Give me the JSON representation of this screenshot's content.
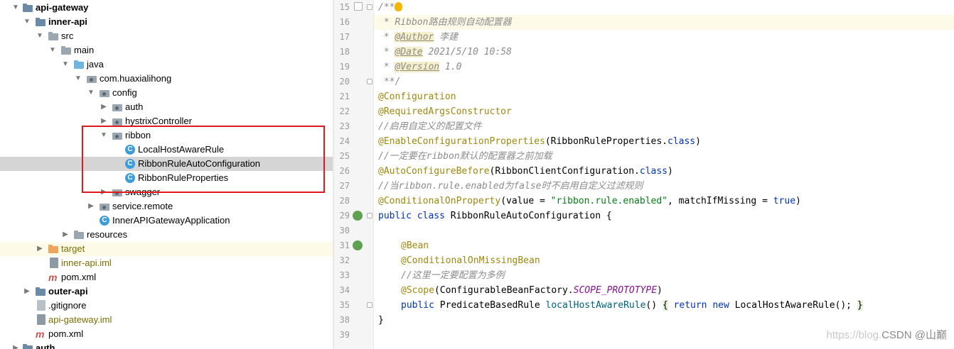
{
  "tree": {
    "rows": [
      {
        "label": "api-gateway"
      },
      {
        "label": "inner-api"
      },
      {
        "label": "src"
      },
      {
        "label": "main"
      },
      {
        "label": "java"
      },
      {
        "label": "com.huaxialihong"
      },
      {
        "label": "config"
      },
      {
        "label": "auth"
      },
      {
        "label": "hystrixController"
      },
      {
        "label": "ribbon"
      },
      {
        "label": "LocalHostAwareRule"
      },
      {
        "label": "RibbonRuleAutoConfiguration"
      },
      {
        "label": "RibbonRuleProperties"
      },
      {
        "label": "swagger"
      },
      {
        "label": "service.remote"
      },
      {
        "label": "InnerAPIGatewayApplication"
      },
      {
        "label": "resources"
      },
      {
        "label": "target"
      },
      {
        "label": "inner-api.iml"
      },
      {
        "label": "pom.xml"
      },
      {
        "label": "outer-api"
      },
      {
        "label": ".gitignore"
      },
      {
        "label": "api-gateway.iml"
      },
      {
        "label": "pom.xml"
      },
      {
        "label": "auth"
      }
    ],
    "class_icon_letter": "C",
    "maven_icon_letter": "m"
  },
  "editor": {
    "line_numbers": [
      "15",
      "16",
      "17",
      "18",
      "19",
      "20",
      "21",
      "22",
      "23",
      "24",
      "25",
      "26",
      "27",
      "28",
      "29",
      "30",
      "31",
      "32",
      "33",
      "34",
      "35",
      "38",
      "39"
    ],
    "lines": {
      "l15": "/**",
      "l16": " * Ribbon路由规则自动配置器",
      "l17a": " * ",
      "l17tag": "@Author",
      "l17b": " 李建",
      "l18a": " * ",
      "l18tag": "@Date",
      "l18b": " 2021/5/10 10:58",
      "l19a": " * ",
      "l19tag": "@Version",
      "l19b": " 1.0",
      "l20": " **/",
      "l21": "@Configuration",
      "l22": "@RequiredArgsConstructor",
      "l23": "//启用自定义的配置文件",
      "l24a": "@EnableConfigurationProperties",
      "l24b": "(RibbonRuleProperties.",
      "l24c": "class",
      "l24d": ")",
      "l25": "//一定要在ribbon默认的配置器之前加载",
      "l26a": "@AutoConfigureBefore",
      "l26b": "(RibbonClientConfiguration.",
      "l26c": "class",
      "l26d": ")",
      "l27": "//当ribbon.rule.enabled为false时不启用自定义过滤规则",
      "l28a": "@ConditionalOnProperty",
      "l28b": "(value = ",
      "l28c": "\"ribbon.rule.enabled\"",
      "l28d": ", matchIfMissing = ",
      "l28e": "true",
      "l28f": ")",
      "l29a": "public class",
      "l29b": " RibbonRuleAutoConfiguration {",
      "l31": "@Bean",
      "l32": "@ConditionalOnMissingBean",
      "l33": "//这里一定要配置为多例",
      "l34a": "@Scope",
      "l34b": "(ConfigurableBeanFactory.",
      "l34c": "SCOPE_PROTOTYPE",
      "l34d": ")",
      "l35a": "public",
      "l35b": " PredicateBasedRule ",
      "l35c": "localHostAwareRule",
      "l35d": "() ",
      "l35e": "{",
      "l35f": " return new",
      "l35g": " LocalHostAwareRule(); ",
      "l35h": "}",
      "l38": "}"
    }
  },
  "watermark": {
    "url": "https://blog.",
    "brand": "CSDN @山巅"
  },
  "colors": {
    "annotation": "#9e880d",
    "keyword": "#0033b3",
    "string": "#067d17",
    "comment": "#8c8c8c",
    "selection": "#d5d5d5",
    "highlight_box": "#e0191e"
  }
}
